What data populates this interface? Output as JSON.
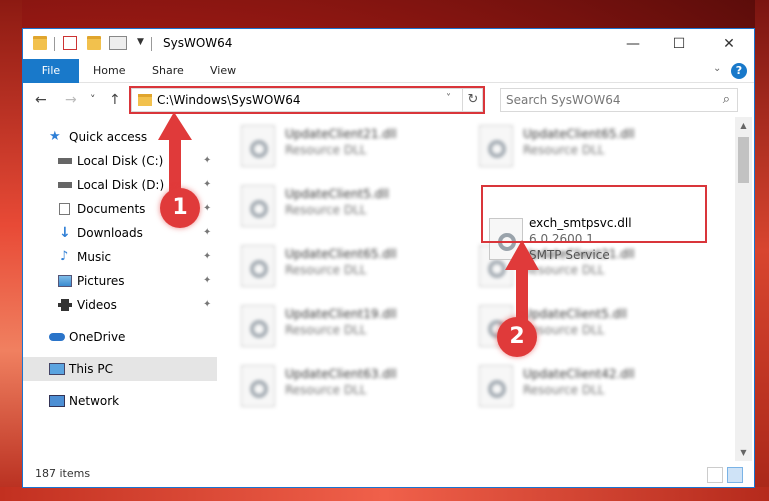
{
  "window": {
    "title": "SysWOW64",
    "minimize": "—",
    "maximize": "☐",
    "close": "✕"
  },
  "ribbon": {
    "file": "File",
    "tabs": [
      "Home",
      "Share",
      "View"
    ],
    "collapse_icon": "chevron-down-icon",
    "help": "?"
  },
  "nav": {
    "back": "←",
    "forward": "→",
    "recent": "˅",
    "up": "↑",
    "address": "C:\\Windows\\SysWOW64",
    "address_dropdown": "˅",
    "refresh": "↻",
    "search_placeholder": "Search SysWOW64",
    "search_icon": "⌕"
  },
  "sidebar": {
    "items": [
      {
        "label": "Quick access",
        "icon": "star-icon",
        "pinned": false
      },
      {
        "label": "Local Disk (C:)",
        "icon": "drive-icon",
        "pinned": true
      },
      {
        "label": "Local Disk (D:)",
        "icon": "drive-icon",
        "pinned": true
      },
      {
        "label": "Documents",
        "icon": "documents-icon",
        "pinned": true
      },
      {
        "label": "Downloads",
        "icon": "downloads-icon",
        "pinned": true
      },
      {
        "label": "Music",
        "icon": "music-icon",
        "pinned": true
      },
      {
        "label": "Pictures",
        "icon": "pictures-icon",
        "pinned": true
      },
      {
        "label": "Videos",
        "icon": "videos-icon",
        "pinned": true
      },
      {
        "label": "OneDrive",
        "icon": "cloud-icon",
        "pinned": false
      },
      {
        "label": "This PC",
        "icon": "computer-icon",
        "pinned": false,
        "selected": true
      },
      {
        "label": "Network",
        "icon": "network-icon",
        "pinned": false
      }
    ],
    "pin_glyph": "📌"
  },
  "files": [
    {
      "name": "UpdateClient21.dll",
      "desc": "Resource DLL"
    },
    {
      "name": "UpdateClient65.dll",
      "desc": "Resource DLL"
    },
    {
      "name": "UpdateClient5.dll",
      "desc": "Resource DLL"
    },
    {
      "name": "UpdateClient65.dll",
      "desc": "Resource DLL"
    },
    {
      "name": "UpdateClient21.dll",
      "desc": "Resource DLL"
    },
    {
      "name": "UpdateClient19.dll",
      "desc": "Resource DLL"
    },
    {
      "name": "UpdateClient5.dll",
      "desc": "Resource DLL"
    },
    {
      "name": "UpdateClient63.dll",
      "desc": "Resource DLL"
    },
    {
      "name": "UpdateClient42.dll",
      "desc": "Resource DLL"
    }
  ],
  "highlighted_file": {
    "name": "exch_smtpsvc.dll",
    "version": "6.0.2600.1",
    "desc": "SMTP Service"
  },
  "status": {
    "count": "187 items"
  },
  "annotations": {
    "step1": "1",
    "step2": "2",
    "color": "#e03a3a"
  }
}
